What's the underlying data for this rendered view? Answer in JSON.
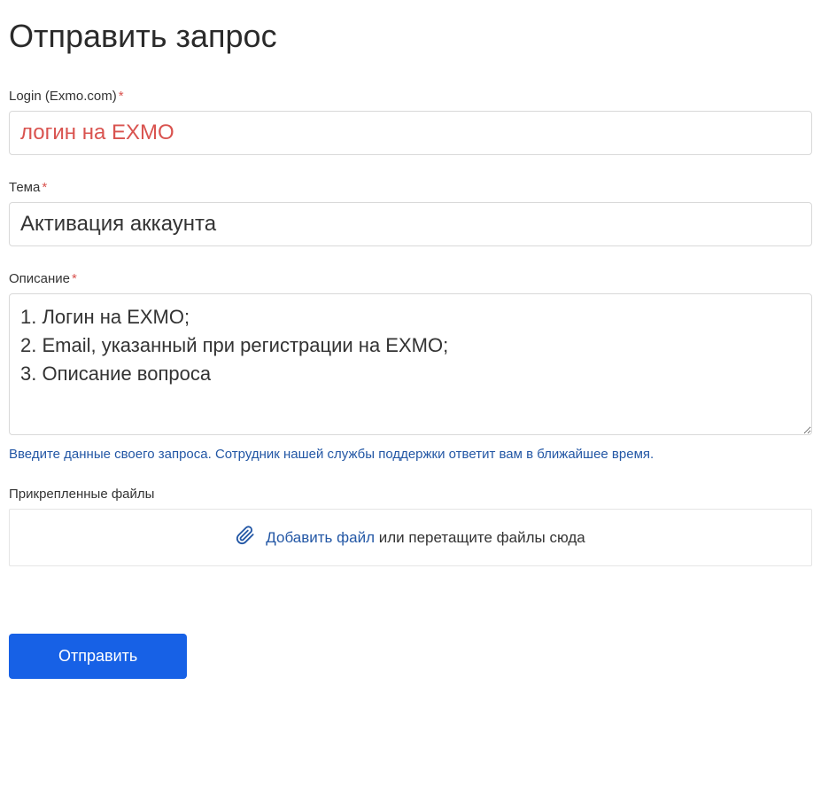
{
  "title": "Отправить запрос",
  "fields": {
    "login": {
      "label": "Login (Exmo.com)",
      "required": "*",
      "value": "логин на EXMO"
    },
    "subject": {
      "label": "Тема",
      "required": "*",
      "value": "Активация аккаунта"
    },
    "description": {
      "label": "Описание",
      "required": "*",
      "value": "1. Логин на EXMO;\n2. Email, указанный при регистрации на EXMO;\n3. Описание вопроса",
      "hint": "Введите данные своего запроса. Сотрудник нашей службы поддержки ответит вам в ближайшее время."
    },
    "attachments": {
      "label": "Прикрепленные файлы",
      "link_text": "Добавить файл",
      "drag_text": " или перетащите файлы сюда"
    }
  },
  "submit_label": "Отправить"
}
